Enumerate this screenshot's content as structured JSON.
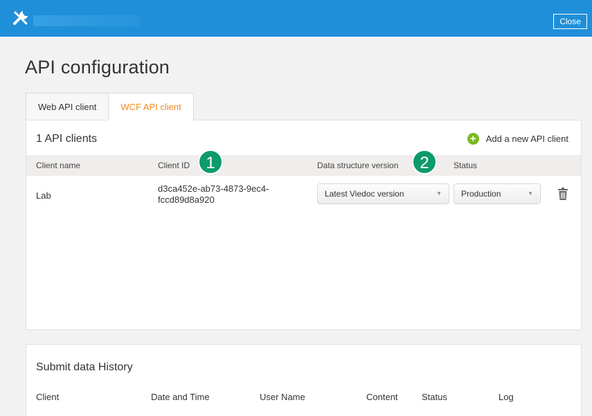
{
  "topbar": {
    "close_label": "Close"
  },
  "page": {
    "title": "API configuration"
  },
  "tabs": [
    {
      "label": "Web API client",
      "active": false
    },
    {
      "label": "WCF API client",
      "active": true
    }
  ],
  "clients_panel": {
    "count_label": "1 API clients",
    "add_label": "Add a new API client",
    "columns": [
      "Client name",
      "Client ID",
      "Data structure version",
      "Status"
    ],
    "rows": [
      {
        "name": "Lab",
        "client_id_line1": "d3ca452e-ab73-4873-9ec4-",
        "client_id_line2": "fccd89d8a920",
        "data_structure_version": "Latest Viedoc version",
        "status": "Production"
      }
    ]
  },
  "badges": [
    "1",
    "2"
  ],
  "history": {
    "title": "Submit data History",
    "columns": [
      "Client",
      "Date and Time",
      "User Name",
      "Content",
      "Status",
      "Log"
    ]
  },
  "colors": {
    "topbar": "#1f8fd9",
    "accent_tab": "#f08c1c",
    "badge": "#0d9a6c",
    "add_icon": "#7bb927"
  }
}
